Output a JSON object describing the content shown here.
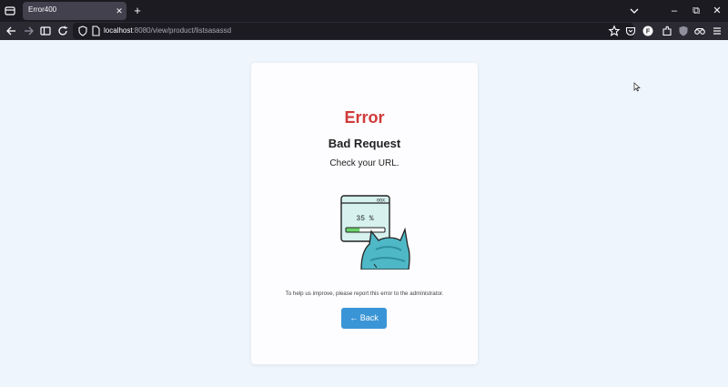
{
  "browser": {
    "tab_title": "Error400",
    "tab_close": "✕",
    "new_tab": "+",
    "url_host": "localhost",
    "url_path": ":8080/view/product/listsasassd",
    "window_minimize": "–",
    "window_restore": "⧉",
    "window_close": "✕"
  },
  "page": {
    "error_title": "Error",
    "error_subtitle": "Bad Request",
    "error_message": "Check your URL.",
    "progress_text": "35 %",
    "progress_value": 35,
    "help_text": "To help us improve, please report this error to the administrator.",
    "back_label": "← Back"
  },
  "colors": {
    "error_red": "#d0393a",
    "button_blue": "#3a95d6",
    "page_bg": "#eef5fc"
  },
  "icons": [
    "tab-list-icon",
    "back-arrow-icon",
    "forward-arrow-icon",
    "sidebar-icon",
    "reload-icon",
    "shield-icon",
    "page-icon",
    "star-icon",
    "pocket-icon",
    "account-icon",
    "extensions-icon",
    "ublock-icon",
    "vpn-icon",
    "menu-icon",
    "chevron-down-icon"
  ]
}
